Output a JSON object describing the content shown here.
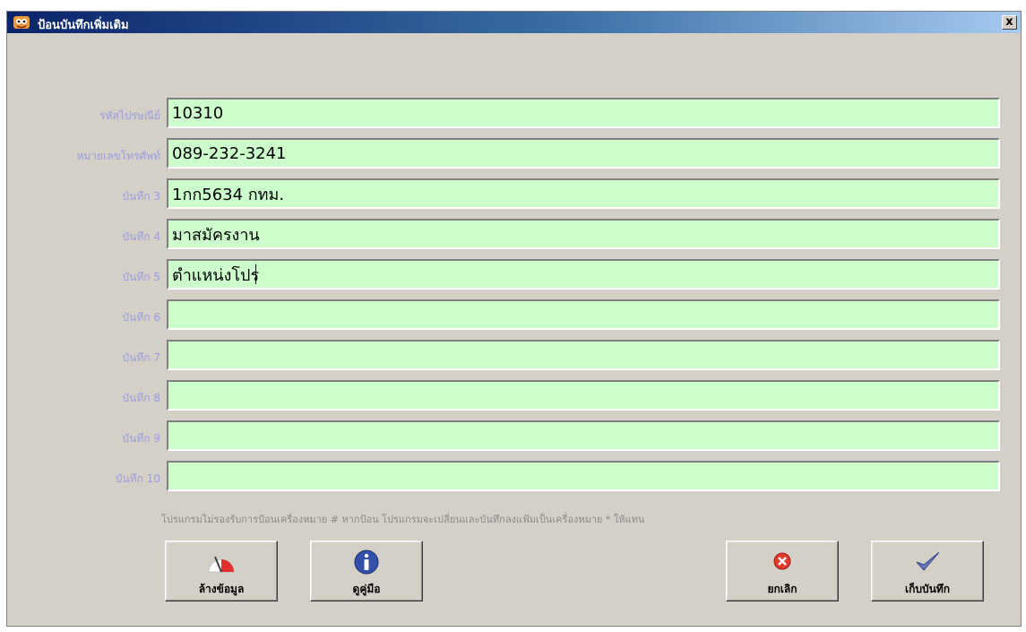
{
  "window": {
    "title": "ป้อนบันทึกเพิ่มเติม",
    "close_label": "x"
  },
  "fields": [
    {
      "label": "รหัสไปรษณีย์",
      "value": "10310"
    },
    {
      "label": "หมายเลขโทรศัพท์",
      "value": "089-232-3241"
    },
    {
      "label": "บันทึก 3",
      "value": "1กก5634 กทม."
    },
    {
      "label": "บันทึก 4",
      "value": "มาสมัครงาน"
    },
    {
      "label": "บันทึก 5",
      "value": "ตำแหน่งโปร"
    },
    {
      "label": "บันทึก 6",
      "value": ""
    },
    {
      "label": "บันทึก 7",
      "value": ""
    },
    {
      "label": "บันทึก 8",
      "value": ""
    },
    {
      "label": "บันทึก 9",
      "value": ""
    },
    {
      "label": "บันทึก 10",
      "value": ""
    }
  ],
  "note": "โปรแกรมไม่รองรับการป้อนเครื่องหมาย # หากป้อน โปรแกรมจะเปลี่ยนและบันทึกลงแฟ้มเป็นเครื่องหมาย * ให้แทน",
  "buttons": {
    "clear": {
      "label": "ล้างข้อมูล",
      "icon": "gauge-icon"
    },
    "help": {
      "label": "ดูคู่มือ",
      "icon": "info-icon"
    },
    "cancel": {
      "label": "ยกเลิก",
      "icon": "cancel-icon"
    },
    "save": {
      "label": "เก็บบันทึก",
      "icon": "checkmark-icon"
    }
  },
  "colors": {
    "field_bg": "#ccffcc",
    "label": "#9b9be3",
    "window_bg": "#d4d0c8",
    "title_start": "#0a246a"
  }
}
